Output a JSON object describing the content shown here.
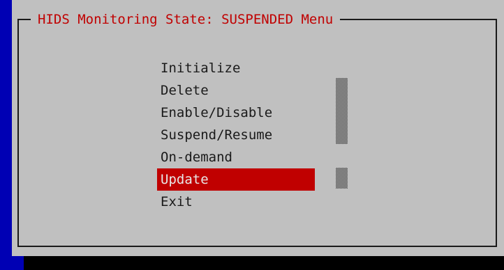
{
  "dialog": {
    "title": "HIDS Monitoring State: SUSPENDED Menu"
  },
  "menu": {
    "items": [
      {
        "label": "Initialize"
      },
      {
        "label": "Delete"
      },
      {
        "label": "Enable/Disable"
      },
      {
        "label": "Suspend/Resume"
      },
      {
        "label": "On-demand"
      },
      {
        "label": "Update"
      },
      {
        "label": "Exit"
      }
    ],
    "selected_index": 5
  },
  "colors": {
    "background": "#0000b4",
    "dialog": "#c0c0c0",
    "title_text": "#c00000",
    "selected_bg": "#c00000",
    "selected_text": "#e8e8e8",
    "item_text": "#1a1a1a"
  }
}
